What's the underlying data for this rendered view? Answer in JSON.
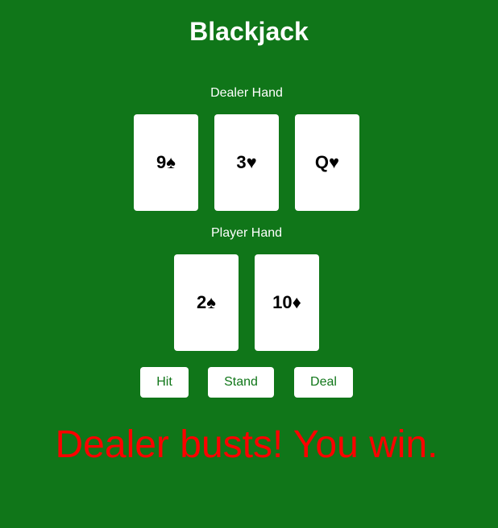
{
  "game": {
    "title": "Blackjack"
  },
  "dealer": {
    "label": "Dealer Hand",
    "cards": [
      "9♠",
      "3♥",
      "Q♥"
    ]
  },
  "player": {
    "label": "Player Hand",
    "cards": [
      "2♠",
      "10♦"
    ]
  },
  "controls": {
    "hit_label": "Hit",
    "stand_label": "Stand",
    "deal_label": "Deal"
  },
  "status": {
    "message": "Dealer busts! You win.",
    "message_color": "#ff0000"
  },
  "colors": {
    "table": "#107619",
    "card": "#ffffff",
    "button_text": "#107619"
  }
}
